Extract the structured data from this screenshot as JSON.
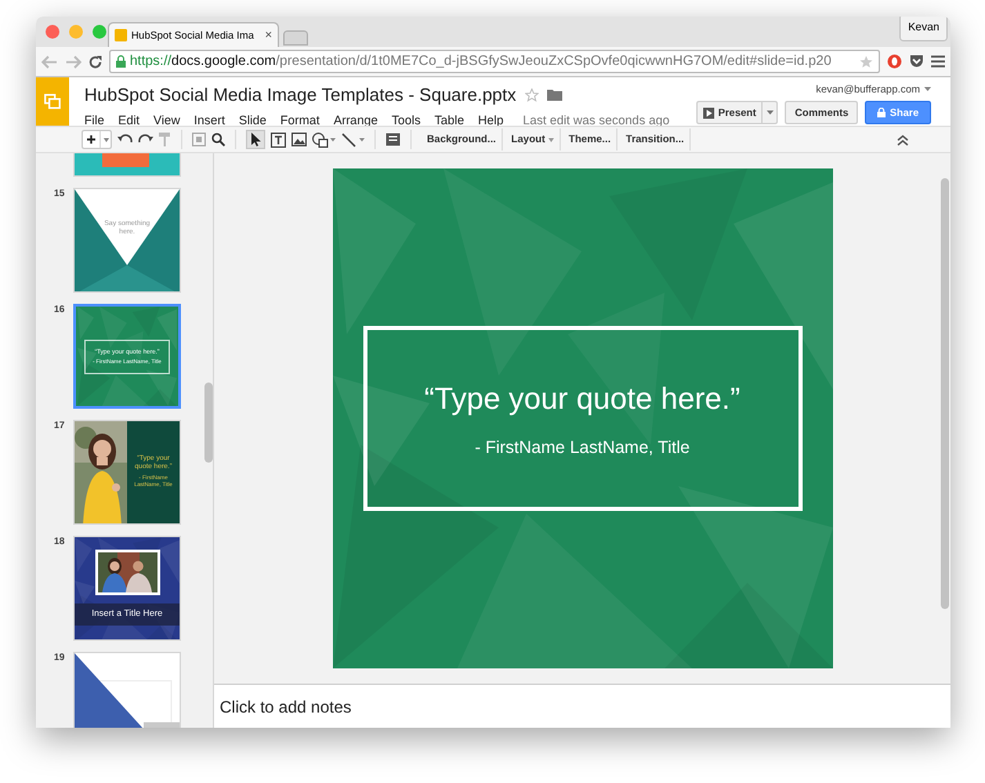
{
  "browser": {
    "tab_title": "HubSpot Social Media Ima",
    "tab_close": "×",
    "profile": "Kevan",
    "url_scheme": "https://",
    "url_host": "docs.google.com",
    "url_path": "/presentation/d/1t0ME7Co_d-jBSGfySwJeouZxCSpOvfe0qicwwnHG7OM/edit#slide=id.p20"
  },
  "app": {
    "doc_title": "HubSpot Social Media Image Templates - Square.pptx",
    "account": "kevan@bufferapp.com",
    "menu": [
      "File",
      "Edit",
      "View",
      "Insert",
      "Slide",
      "Format",
      "Arrange",
      "Tools",
      "Table",
      "Help"
    ],
    "last_edit": "Last edit was seconds ago",
    "present": "Present",
    "comments": "Comments",
    "share": "Share"
  },
  "toolbar": {
    "text_buttons": [
      {
        "label": "Background...",
        "dropdown": false
      },
      {
        "label": "Layout",
        "dropdown": true
      },
      {
        "label": "Theme...",
        "dropdown": false
      },
      {
        "label": "Transition...",
        "dropdown": false
      }
    ]
  },
  "thumbnails": [
    {
      "kind": "teal-bottom",
      "selected": false
    },
    {
      "number": "15",
      "kind": "triangle",
      "selected": false,
      "texts": [
        "Say something here."
      ]
    },
    {
      "number": "16",
      "kind": "quote",
      "selected": true,
      "texts": [
        "“Type your quote here.”",
        "- FirstName LastName, Title"
      ]
    },
    {
      "number": "17",
      "kind": "photo-quote",
      "selected": false,
      "texts": [
        "“Type your quote here.”",
        "- FirstName LastName, Title"
      ]
    },
    {
      "number": "18",
      "kind": "photo-title",
      "selected": false,
      "texts": [
        "Insert a Title Here"
      ]
    },
    {
      "number": "19",
      "kind": "diagonal",
      "selected": false
    }
  ],
  "slide": {
    "quote": "“Type your quote here.”",
    "attribution": "- FirstName LastName, Title"
  },
  "notes": {
    "placeholder": "Click to add notes"
  }
}
